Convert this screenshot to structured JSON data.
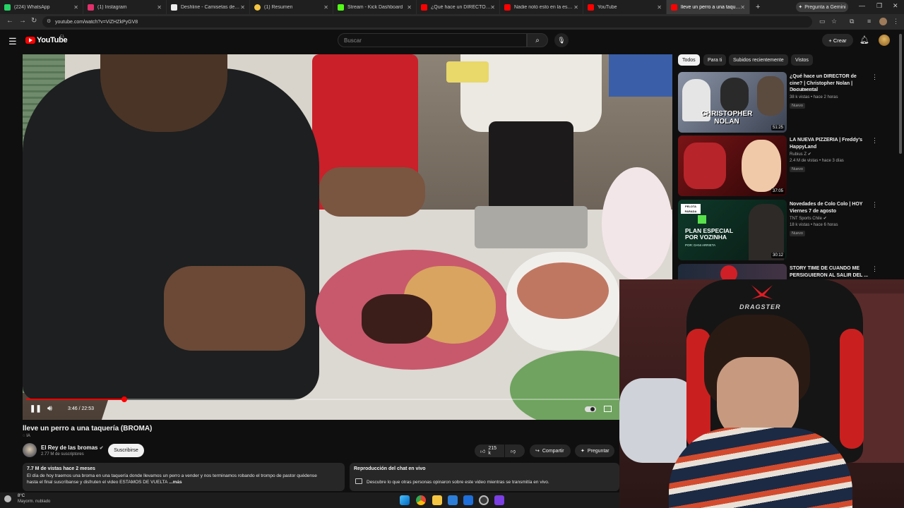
{
  "browser": {
    "tabs": [
      {
        "label": "(224) WhatsApp",
        "color": "#25d366"
      },
      {
        "label": "(1) Instagram",
        "color": "#e1306c"
      },
      {
        "label": "Deshline - Camisetas de Fútbol",
        "color": "#eeeeee"
      },
      {
        "label": "(1) Resumen",
        "color": "#f4c542"
      },
      {
        "label": "Stream - Kick Dashboard",
        "color": "#53fc18"
      },
      {
        "label": "¿Qué hace un DIRECTOR de cine?",
        "color": "#ff0000"
      },
      {
        "label": "Nadie notó esto en la escena",
        "color": "#ff0000"
      },
      {
        "label": "YouTube",
        "color": "#ff0000"
      },
      {
        "label": "lleve un perro a una taquería",
        "color": "#ff0000"
      }
    ],
    "new_tab": "+",
    "gemini_button": "Pregunta a Gemini",
    "url": "youtube.com/watch?v=ViZHZkPyGV8"
  },
  "youtube": {
    "logo_text": "YouTube",
    "country_code": "CL",
    "search_placeholder": "Buscar",
    "create_label": "+ Crear"
  },
  "player": {
    "time_current": "3:46",
    "time_total": "22:53",
    "time_display": "3:46 / 22:53",
    "progress_fraction": 0.165
  },
  "video": {
    "title": "lleve un perro a una taquería (BROMA)",
    "ai_badge": "IA",
    "channel_name": "El Rey de las bromas",
    "channel_subs": "2.77 M de suscriptores",
    "subscribe_label": "Suscribirse",
    "likes": "215 k",
    "share_label": "Compartir",
    "ask_label": "Preguntar",
    "views_date": "7.7 M de vistas  hace 2 meses",
    "description_line1": "El día de hoy traemos una broma en una  taquería donde llevamos un perro a vender y nos terminamos robando el trompo de pastor quédense",
    "description_line2": "hasta el final suscríbanse y disfruten el video ESTAMOS DE VUELTA",
    "description_more": " ...más",
    "chat_replay_title": "Reproducción del chat en vivo",
    "chat_replay_text": "Descubre lo que otras personas opinaron sobre este video mientras se transmitía en vivo."
  },
  "sidebar": {
    "chips": [
      "Todos",
      "Para ti",
      "Subidos recientemente",
      "Vistos"
    ],
    "recommendations": [
      {
        "title": "¿Qué hace un DIRECTOR de cine? | Christopher Nolan | Documental",
        "channel": "Dieck Docs",
        "meta": "38 k vistas • hace 2 horas",
        "badge": "Nuevo",
        "duration": "51:25",
        "thumb_text": "CHRISTOPHER NOLAN"
      },
      {
        "title": "LA NUEVA PIZZERIA | Freddy's HappyLand",
        "channel": "Rubius Z",
        "meta": "2.4 M de vistas • hace 3 días",
        "badge": "Nuevo",
        "duration": "37:05",
        "thumb_text": ""
      },
      {
        "title": "Novedades de Colo Colo | HOY Viernes 7 de agosto",
        "channel": "TNT Sports Chile",
        "meta": "18 k vistas • hace 6 horas",
        "badge": "Nuevo",
        "duration": "30:12",
        "thumb_text": "PLAN ESPECIAL POR VOZINHA",
        "thumb_subtext": "POR: DANI ARRIETA",
        "thumb_logo": "PELOTA PARADA"
      },
      {
        "title": "STORY TIME DE CUANDO ME PERSIGUIERON AL SALIR DEL ...",
        "channel": "",
        "meta": "",
        "badge": "",
        "duration": "",
        "thumb_text": ""
      }
    ]
  },
  "webcam": {
    "chair_brand": "DRAGSTER"
  },
  "taskbar": {
    "temperature": "8°C",
    "weather": "Mayorm. nublado"
  }
}
